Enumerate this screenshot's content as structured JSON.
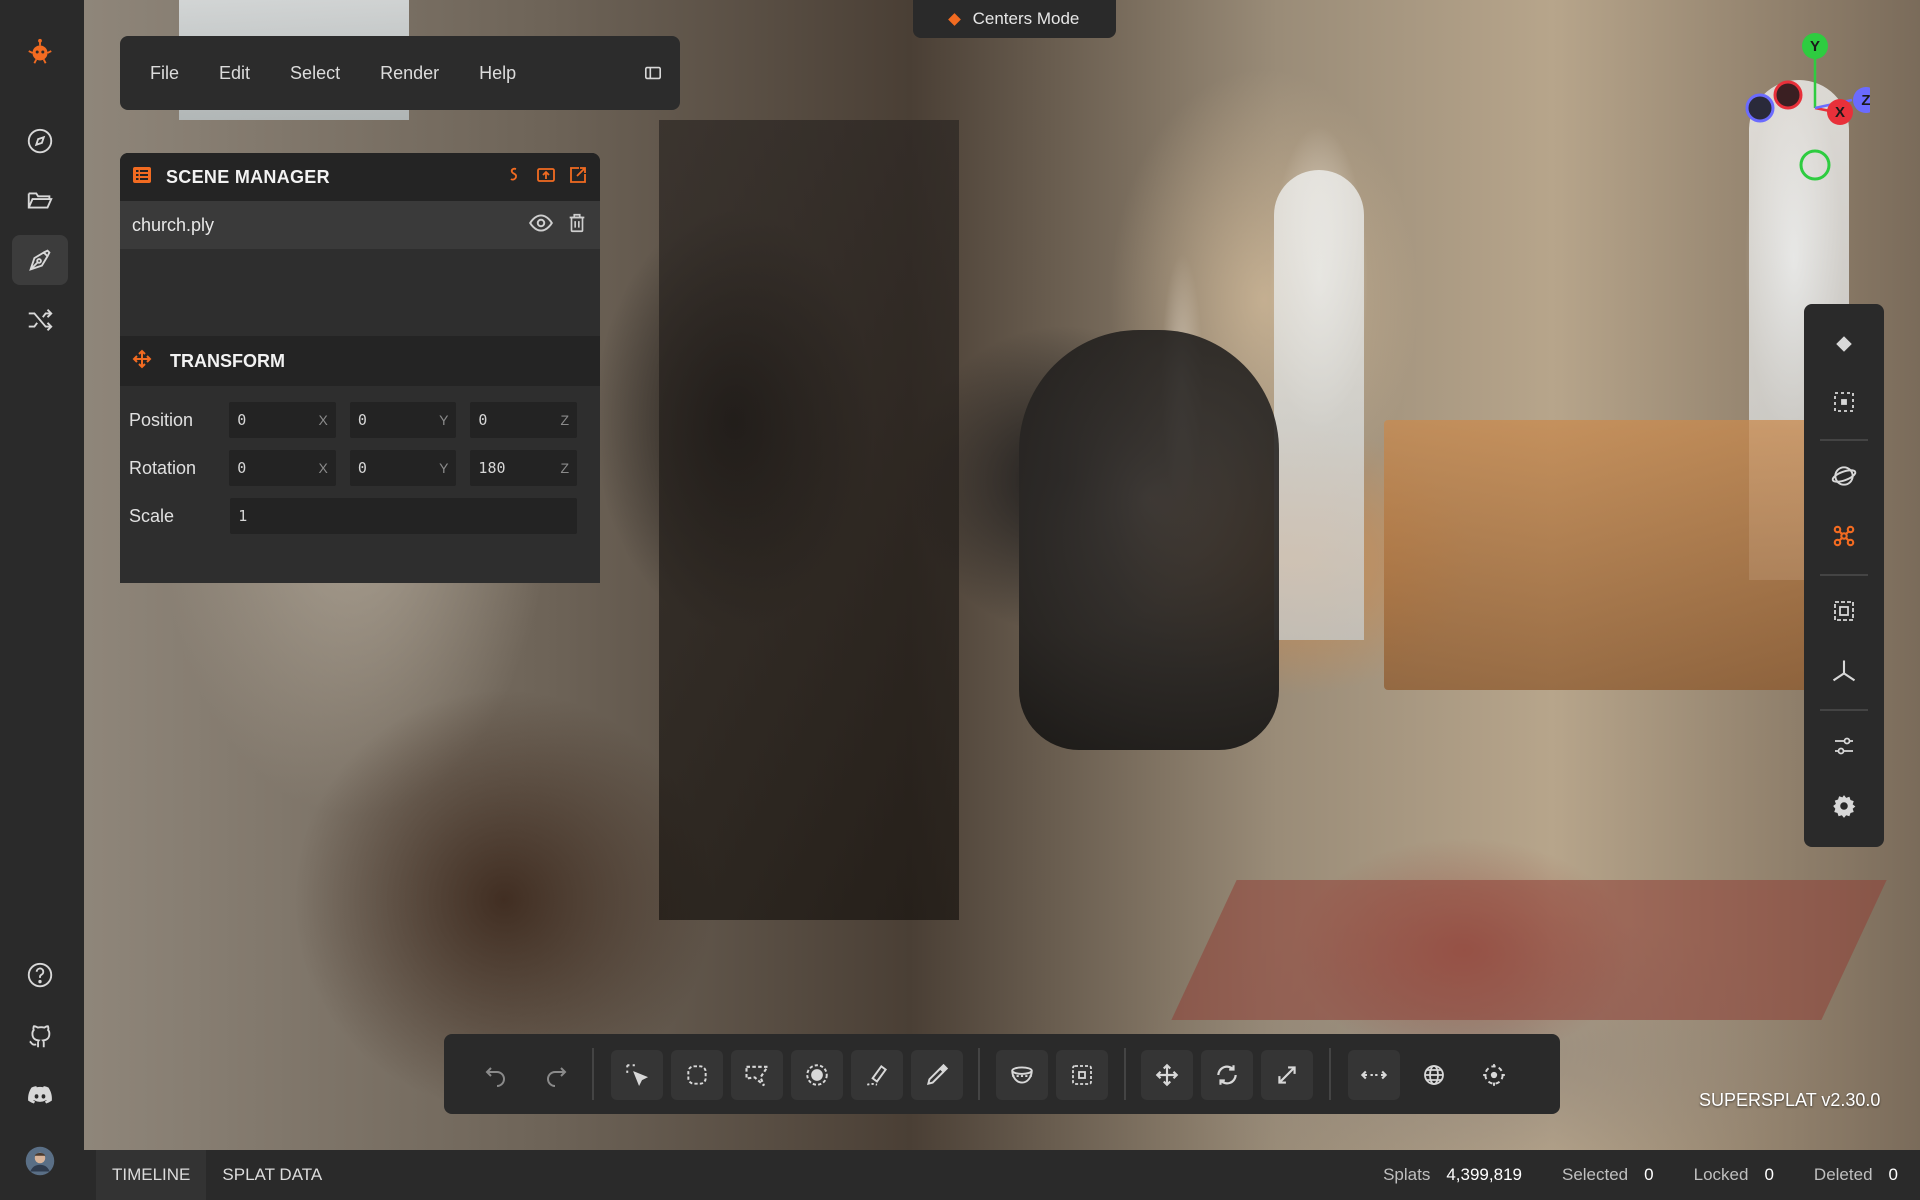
{
  "app": {
    "version_label": "SUPERSPLAT v2.30.0",
    "accent": "#f26b21"
  },
  "menu": {
    "items": [
      "File",
      "Edit",
      "Select",
      "Render",
      "Help"
    ]
  },
  "mode_pill": {
    "label": "Centers Mode"
  },
  "scene_manager": {
    "title": "SCENE MANAGER",
    "files": [
      {
        "name": "church.ply"
      }
    ]
  },
  "transform": {
    "title": "TRANSFORM",
    "position": {
      "label": "Position",
      "x": "0",
      "y": "0",
      "z": "0"
    },
    "rotation": {
      "label": "Rotation",
      "x": "0",
      "y": "0",
      "z": "180"
    },
    "scale": {
      "label": "Scale",
      "value": "1"
    },
    "axis_labels": {
      "x": "X",
      "y": "Y",
      "z": "Z"
    }
  },
  "gizmo": {
    "y": "Y",
    "x": "X",
    "z": "Z"
  },
  "statusbar": {
    "tabs": [
      "TIMELINE",
      "SPLAT DATA"
    ],
    "splats_label": "Splats",
    "splats_value": "4,399,819",
    "selected_label": "Selected",
    "selected_value": "0",
    "locked_label": "Locked",
    "locked_value": "0",
    "deleted_label": "Deleted",
    "deleted_value": "0"
  },
  "icons": {
    "sidebar": [
      "logo-icon",
      "compass-icon",
      "folder-open-icon",
      "pen-tool-icon",
      "shuffle-icon",
      "help-icon",
      "github-icon",
      "discord-icon",
      "avatar"
    ],
    "right_toolbar": [
      "diamond-icon",
      "focus-frame-icon",
      "orbit-icon",
      "splat-centers-icon",
      "bound-box-icon",
      "axes-icon",
      "sliders-icon",
      "settings-icon"
    ],
    "bottom_toolbar": [
      "undo-icon",
      "redo-icon",
      "picker-icon",
      "lasso-icon",
      "polygon-icon",
      "brush-icon",
      "flood-icon",
      "eyedropper-icon",
      "sphere-icon",
      "box-icon",
      "move-icon",
      "rotate-icon",
      "scale-icon",
      "local-space-icon",
      "global-icon",
      "pivot-icon"
    ]
  }
}
